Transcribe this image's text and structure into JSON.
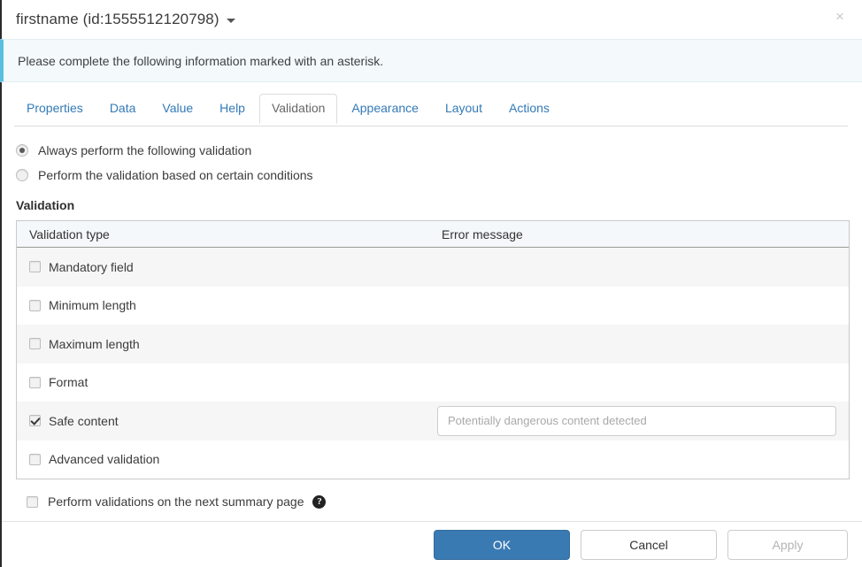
{
  "window": {
    "title": "firstname (id:1555512120798)",
    "caret_icon": "chevron-down-icon",
    "close_icon": "close-icon",
    "close_label": "×"
  },
  "banner": {
    "text": "Please complete the following information marked with an asterisk.",
    "accent_color": "#5bc0de",
    "background_color": "#f4f9fb"
  },
  "tabs": {
    "active": "Validation",
    "items": [
      {
        "label": "Properties",
        "active": false
      },
      {
        "label": "Data",
        "active": false
      },
      {
        "label": "Value",
        "active": false
      },
      {
        "label": "Help",
        "active": false
      },
      {
        "label": "Validation",
        "active": true
      },
      {
        "label": "Appearance",
        "active": false
      },
      {
        "label": "Layout",
        "active": false
      },
      {
        "label": "Actions",
        "active": false
      }
    ]
  },
  "validation_mode": {
    "options": [
      {
        "label": "Always perform the following validation",
        "checked": true
      },
      {
        "label": "Perform the validation based on certain conditions",
        "checked": false
      }
    ]
  },
  "section": {
    "title": "Validation"
  },
  "table": {
    "columns": [
      "Validation type",
      "Error message"
    ],
    "rows": [
      {
        "type": "Mandatory field",
        "checked": false,
        "has_input": false,
        "placeholder": "",
        "value": ""
      },
      {
        "type": "Minimum length",
        "checked": false,
        "has_input": false,
        "placeholder": "",
        "value": ""
      },
      {
        "type": "Maximum length",
        "checked": false,
        "has_input": false,
        "placeholder": "",
        "value": ""
      },
      {
        "type": "Format",
        "checked": false,
        "has_input": false,
        "placeholder": "",
        "value": ""
      },
      {
        "type": "Safe content",
        "checked": true,
        "has_input": true,
        "placeholder": "Potentially dangerous content detected",
        "value": ""
      },
      {
        "type": "Advanced validation",
        "checked": false,
        "has_input": false,
        "placeholder": "",
        "value": ""
      }
    ]
  },
  "summary_option": {
    "label": "Perform validations on the next summary page",
    "checked": false,
    "help_icon": "help-icon",
    "help_glyph": "?"
  },
  "footer": {
    "ok_label": "OK",
    "cancel_label": "Cancel",
    "apply_label": "Apply",
    "primary_color": "#3a7ab3"
  }
}
